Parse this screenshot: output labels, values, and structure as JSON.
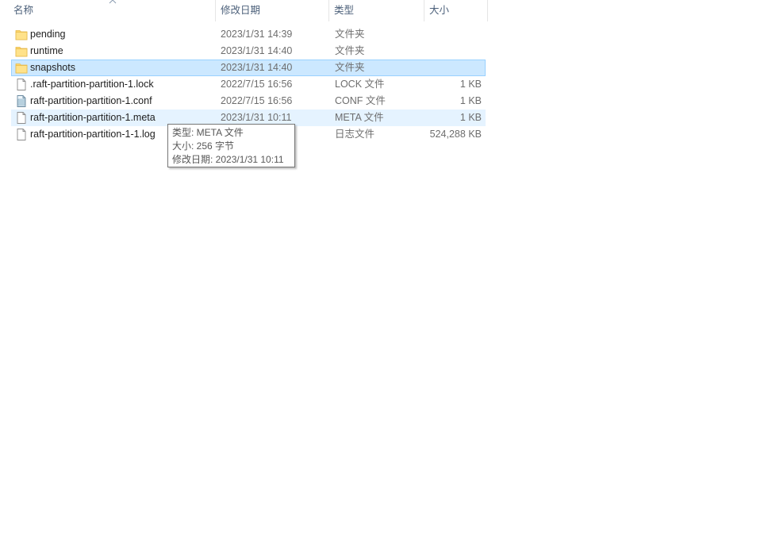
{
  "header": {
    "name": "名称",
    "date": "修改日期",
    "type": "类型",
    "size": "大小",
    "sort_icon": "chevron-up-icon"
  },
  "files": [
    {
      "name": "pending",
      "date": "2023/1/31 14:39",
      "type": "文件夹",
      "size": "",
      "icon": "folder-icon",
      "state": ""
    },
    {
      "name": "runtime",
      "date": "2023/1/31 14:40",
      "type": "文件夹",
      "size": "",
      "icon": "folder-icon",
      "state": ""
    },
    {
      "name": "snapshots",
      "date": "2023/1/31 14:40",
      "type": "文件夹",
      "size": "",
      "icon": "folder-icon",
      "state": "selected"
    },
    {
      "name": ".raft-partition-partition-1.lock",
      "date": "2022/7/15 16:56",
      "type": "LOCK 文件",
      "size": "1 KB",
      "icon": "file-icon",
      "state": ""
    },
    {
      "name": "raft-partition-partition-1.conf",
      "date": "2022/7/15 16:56",
      "type": "CONF 文件",
      "size": "1 KB",
      "icon": "config-file-icon",
      "state": ""
    },
    {
      "name": "raft-partition-partition-1.meta",
      "date": "2023/1/31 10:11",
      "type": "META 文件",
      "size": "1 KB",
      "icon": "file-icon",
      "state": "hover"
    },
    {
      "name": "raft-partition-partition-1-1.log",
      "date": "",
      "type": "日志文件",
      "size": "524,288 KB",
      "icon": "file-icon",
      "state": ""
    }
  ],
  "tooltip": {
    "type_line": "类型: META 文件",
    "size_line": "大小: 256 字节",
    "date_line": "修改日期: 2023/1/31 10:11"
  },
  "colors": {
    "selected_bg": "#cce8ff",
    "selected_border": "#99d1ff",
    "hover_bg": "#e5f3ff",
    "header_text": "#4c607a",
    "folder": "#ffd86b"
  }
}
